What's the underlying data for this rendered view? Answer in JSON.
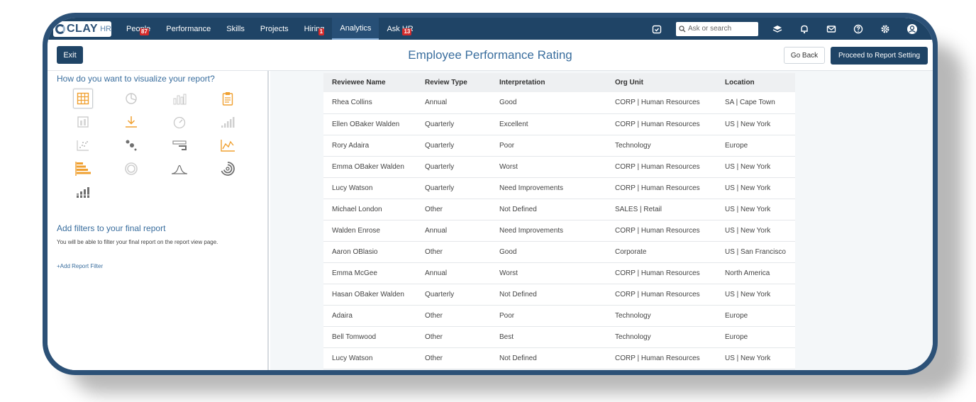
{
  "app": {
    "logo": "CLAY",
    "logo_sub": "HR"
  },
  "nav": {
    "items": [
      {
        "label": "People",
        "badge": "87"
      },
      {
        "label": "Performance",
        "badge": ""
      },
      {
        "label": "Skills",
        "badge": ""
      },
      {
        "label": "Projects",
        "badge": ""
      },
      {
        "label": "Hiring",
        "badge": "1"
      },
      {
        "label": "Analytics",
        "badge": "",
        "active": true
      },
      {
        "label": "Ask HR",
        "badge": "13"
      }
    ],
    "search_placeholder": "Ask or search"
  },
  "header": {
    "exit_label": "Exit",
    "title": "Employee Performance Rating",
    "back_label": "Go Back",
    "proceed_label": "Proceed to Report Setting"
  },
  "left_panel": {
    "viz_question": "How do you want to visualize your report?",
    "viz_icons": [
      "table-icon",
      "pie-chart-icon",
      "bar-chart-icon",
      "clipboard-icon",
      "card-icon",
      "download-icon",
      "gauge-icon",
      "ascending-bars-icon",
      "scatter-icon",
      "bubble-icon",
      "funnel-icon",
      "line-chart-icon",
      "horizontal-bar-icon",
      "donut-icon",
      "bell-curve-icon",
      "radial-icon",
      "stacked-bars-icon"
    ],
    "filter_title": "Add filters to your final report",
    "filter_desc": "You will be able to filter your final report on the report view page.",
    "filter_link": "+Add Report Filter"
  },
  "table": {
    "headers": [
      "Reviewee Name",
      "Review Type",
      "Interpretation",
      "Org Unit",
      "Location"
    ],
    "rows": [
      [
        "Rhea Collins",
        "Annual",
        "Good",
        "CORP | Human Resources",
        "SA | Cape Town"
      ],
      [
        "Ellen OBaker Walden",
        "Quarterly",
        "Excellent",
        "CORP | Human Resources",
        "US | New York"
      ],
      [
        "Rory Adaira",
        "Quarterly",
        "Poor",
        "Technology",
        "Europe"
      ],
      [
        "Emma OBaker Walden",
        "Quarterly",
        "Worst",
        "CORP | Human Resources",
        "US | New York"
      ],
      [
        "Lucy Watson",
        "Quarterly",
        "Need Improvements",
        "CORP | Human Resources",
        "US | New York"
      ],
      [
        "Michael London",
        "Other",
        "Not Defined",
        "SALES | Retail",
        "US | New York"
      ],
      [
        "Walden Enrose",
        "Annual",
        "Need Improvements",
        "CORP | Human Resources",
        "US | New York"
      ],
      [
        "Aaron OBlasio",
        "Other",
        "Good",
        "Corporate",
        "US | San Francisco"
      ],
      [
        "Emma McGee",
        "Annual",
        "Worst",
        "CORP | Human Resources",
        "North America"
      ],
      [
        "Hasan OBaker Walden",
        "Quarterly",
        "Not Defined",
        "CORP | Human Resources",
        "US | New York"
      ],
      [
        "Adaira",
        "Other",
        "Poor",
        "Technology",
        "Europe"
      ],
      [
        "Bell Tomwood",
        "Other",
        "Best",
        "Technology",
        "Europe"
      ],
      [
        "Lucy Watson",
        "Other",
        "Not Defined",
        "CORP | Human Resources",
        "US | New York"
      ]
    ]
  },
  "colors": {
    "nav_bg": "#1f4466",
    "accent": "#3a6e9e",
    "orange": "#f0a030",
    "badge": "#d42b2b"
  }
}
